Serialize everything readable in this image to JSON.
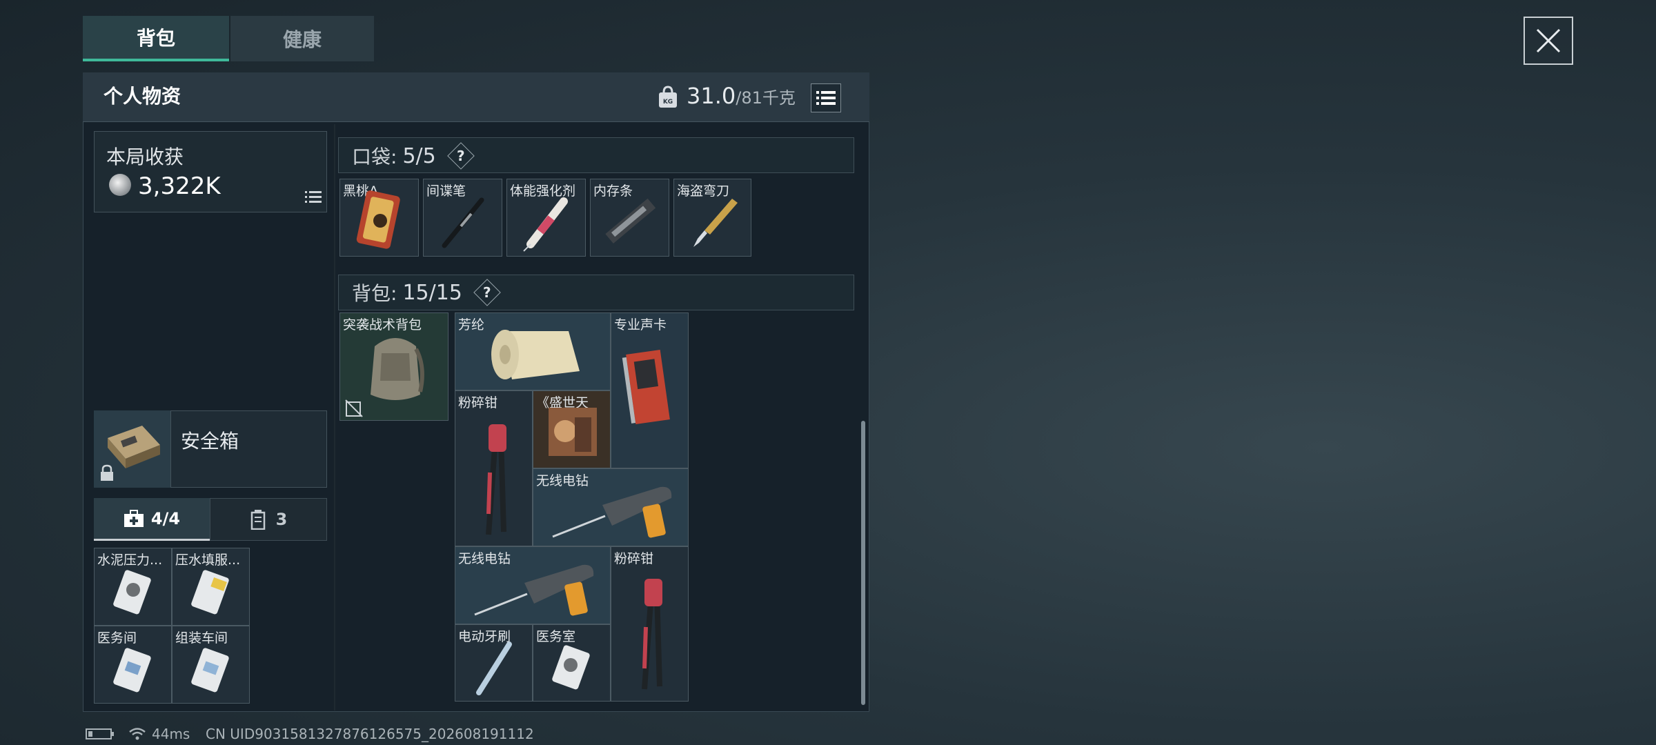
{
  "tabs": [
    "背包",
    "健康"
  ],
  "panel": {
    "title": "个人物资",
    "weight_current": "31.0",
    "weight_capacity": "/81千克"
  },
  "harvest": {
    "label": "本局收获",
    "value": "3,322K"
  },
  "safe_box": {
    "label": "安全箱"
  },
  "subtabs": {
    "medical": "4/4",
    "ammo": "3"
  },
  "medical_items": [
    "水泥压力...",
    "压水填服...",
    "医务间",
    "组装车间"
  ],
  "pocket": {
    "label": "口袋:",
    "count": "5/5",
    "help": "?",
    "items": [
      "黑桃A",
      "间谍笔",
      "体能强化剂",
      "内存条",
      "海盗弯刀"
    ]
  },
  "backpack": {
    "label": "背包:",
    "count": "15/15",
    "help": "?",
    "container": "突袭战术背包",
    "items": [
      "芳纶",
      "专业声卡",
      "粉碎钳",
      "《盛世天",
      "无线电钻",
      "无线电钻",
      "粉碎钳",
      "电动牙刷",
      "医务室"
    ]
  },
  "status": {
    "ping": "44ms",
    "uid": "CN UID903158132787612657​5_202608191112"
  },
  "colors": {
    "accent": "#3fb99a",
    "panel_bg": "#16212a",
    "header_bg": "#2b3943"
  }
}
